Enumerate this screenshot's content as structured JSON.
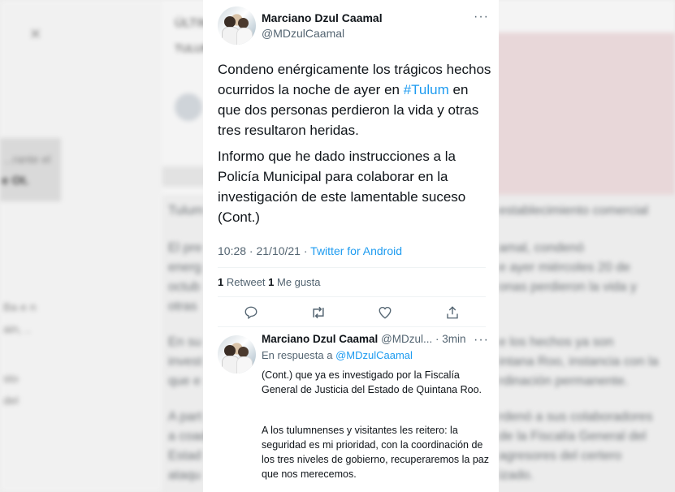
{
  "background": {
    "header_lines": [
      "ÚLTIMA HORA",
      "TULUM"
    ],
    "side_texts": [
      "...rante el",
      "e Ot.",
      "Ba e n",
      "ain, ..",
      "sto",
      "del"
    ],
    "left_col": [
      "Tulum",
      "El pre",
      "energ",
      "octub",
      "otras",
      "En su",
      "invest",
      "que e",
      "A part",
      "a coad",
      "Estad",
      "ataqu"
    ],
    "right_col": [
      "establecimiento comercial",
      "amal, condenó",
      "e ayer miércoles 20 de",
      "onas perdieron la vida y",
      "",
      "e los hechos ya son",
      "intana Roo, instancia con la",
      "rdinación permanente.",
      "rdenó a sus colaboradores",
      "de la Fiscalía General del",
      "agresores del certero",
      "izado."
    ]
  },
  "tweet": {
    "author_name": "Marciano Dzul Caamal",
    "author_handle": "@MDzulCaamal",
    "more_label": "···",
    "paragraph1_before": "Condeno enérgicamente los trágicos hechos ocurridos la noche de ayer en ",
    "hashtag": "#Tulum",
    "paragraph1_after": " en que dos personas perdieron la vida y otras tres resultaron heridas.",
    "paragraph2": "Informo que he dado instrucciones a la Policía Municipal para colaborar en la investigación de este lamentable suceso (Cont.)",
    "timestamp": "10:28 · 21/10/21 · ",
    "source": "Twitter for Android",
    "retweets_count": "1",
    "retweets_label": " Retweet ",
    "likes_count": "1",
    "likes_label": " Me gusta"
  },
  "actions": [
    "reply-icon",
    "retweet-icon",
    "like-icon",
    "share-icon"
  ],
  "reply": {
    "author_name": "Marciano Dzul Caamal",
    "author_handle": "@MDzul...",
    "time": " · 3min",
    "more_label": "···",
    "in_reply_prefix": "En respuesta a ",
    "in_reply_handle": "@MDzulCaamal",
    "paragraph1": "(Cont.) que ya es investigado por la Fiscalía General de Justicia del Estado de Quintana Roo.",
    "paragraph2": "A los tulumnenses y visitantes les reitero: la seguridad es mi prioridad, con la coordinación de los tres niveles de gobierno, recuperaremos la paz que nos merecemos."
  },
  "colors": {
    "accent": "#1d9bf0",
    "text": "#0f1419",
    "muted": "#536471"
  }
}
